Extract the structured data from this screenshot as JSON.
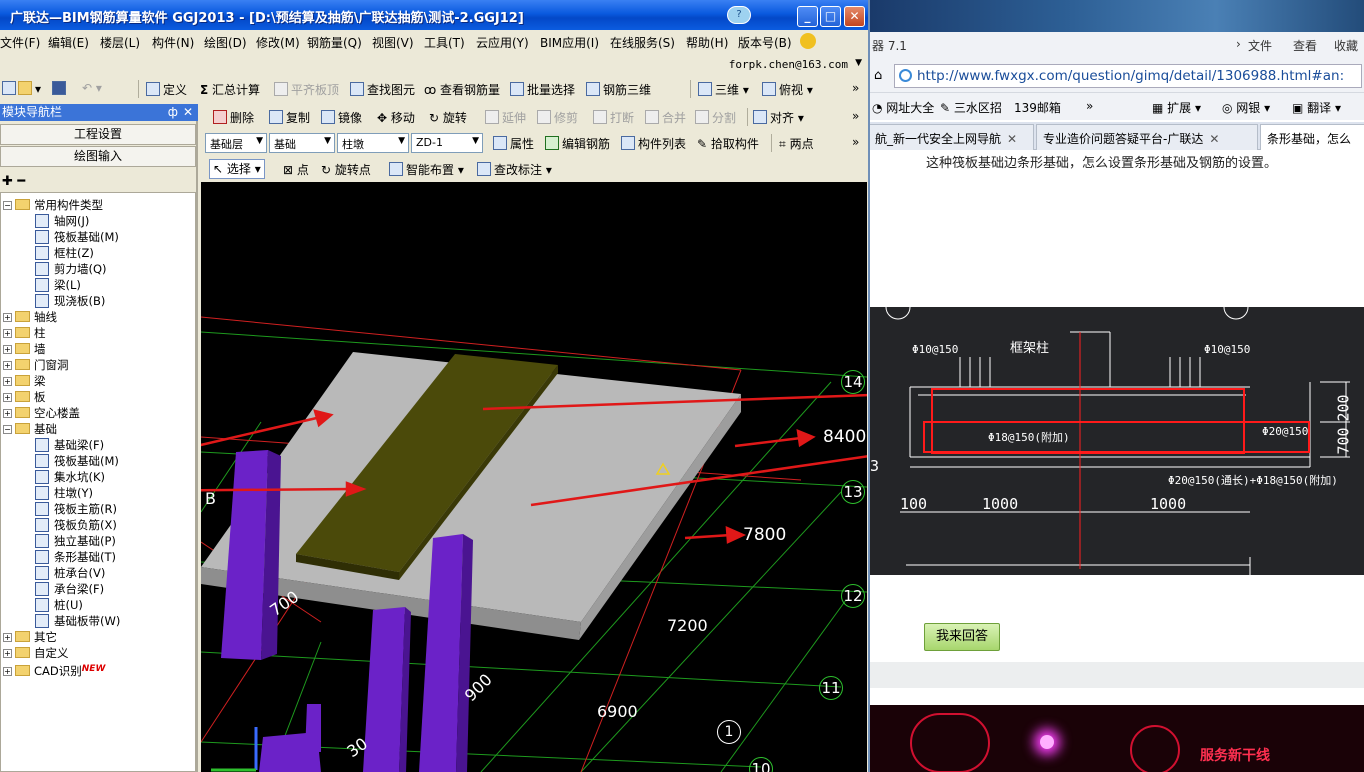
{
  "app": {
    "title": "广联达—BIM钢筋算量软件 GGJ2013 - [D:\\预结算及抽筋\\广联达抽筋\\测试-2.GGJ12]",
    "help_icon": "?",
    "win_buttons": {
      "minimize": "_",
      "maximize": "□",
      "close": "✕"
    },
    "menu": [
      "文件(F)",
      "编辑(E)",
      "楼层(L)",
      "构件(N)",
      "绘图(D)",
      "修改(M)",
      "钢筋量(Q)",
      "视图(V)",
      "工具(T)",
      "云应用(Y)",
      "BIM应用(I)",
      "在线服务(S)",
      "帮助(H)",
      "版本号(B)"
    ],
    "user_email": "forpk.chen@163.com",
    "toolbar1": {
      "define": "定义",
      "sum": "汇总计算",
      "flush": "平齐板顶",
      "find": "查找图元",
      "view_rebar": "查看钢筋量",
      "batch_select": "批量选择",
      "rebar_3d": "钢筋三维",
      "view_3d": "三维",
      "view_top": "俯视"
    },
    "toolbar2": {
      "delete": "删除",
      "copy": "复制",
      "mirror": "镜像",
      "move": "移动",
      "rotate": "旋转",
      "extend": "延伸",
      "trim": "修剪",
      "break": "打断",
      "merge": "合并",
      "split": "分割",
      "align": "对齐"
    },
    "toolbar3": {
      "layer": "基础层",
      "category": "基础",
      "type": "柱墩",
      "component": "ZD-1",
      "properties": "属性",
      "edit_rebar": "编辑钢筋",
      "component_list": "构件列表",
      "pick": "拾取构件",
      "two_points": "两点"
    },
    "toolbar4": {
      "select": "选择",
      "point": "点",
      "rotate_point": "旋转点",
      "smart_place": "智能布置",
      "modify_label": "查改标注"
    },
    "nav": {
      "title": "模块导航栏",
      "pin": "ф",
      "close": "✕",
      "btn_project": "工程设置",
      "btn_draw": "绘图输入",
      "tools": "✚ ━",
      "tree": [
        {
          "label": "常用构件类型",
          "level": 0,
          "kind": "folder",
          "expanded": true
        },
        {
          "label": "轴网(J)",
          "level": 1,
          "kind": "item"
        },
        {
          "label": "筏板基础(M)",
          "level": 1,
          "kind": "item"
        },
        {
          "label": "框柱(Z)",
          "level": 1,
          "kind": "item"
        },
        {
          "label": "剪力墙(Q)",
          "level": 1,
          "kind": "item"
        },
        {
          "label": "梁(L)",
          "level": 1,
          "kind": "item"
        },
        {
          "label": "现浇板(B)",
          "level": 1,
          "kind": "item"
        },
        {
          "label": "轴线",
          "level": 0,
          "kind": "folder",
          "expanded": false
        },
        {
          "label": "柱",
          "level": 0,
          "kind": "folder",
          "expanded": false
        },
        {
          "label": "墙",
          "level": 0,
          "kind": "folder",
          "expanded": false
        },
        {
          "label": "门窗洞",
          "level": 0,
          "kind": "folder",
          "expanded": false
        },
        {
          "label": "梁",
          "level": 0,
          "kind": "folder",
          "expanded": false
        },
        {
          "label": "板",
          "level": 0,
          "kind": "folder",
          "expanded": false
        },
        {
          "label": "空心楼盖",
          "level": 0,
          "kind": "folder",
          "expanded": false
        },
        {
          "label": "基础",
          "level": 0,
          "kind": "folder",
          "expanded": true
        },
        {
          "label": "基础梁(F)",
          "level": 1,
          "kind": "item"
        },
        {
          "label": "筏板基础(M)",
          "level": 1,
          "kind": "item"
        },
        {
          "label": "集水坑(K)",
          "level": 1,
          "kind": "item"
        },
        {
          "label": "柱墩(Y)",
          "level": 1,
          "kind": "item"
        },
        {
          "label": "筏板主筋(R)",
          "level": 1,
          "kind": "item"
        },
        {
          "label": "筏板负筋(X)",
          "level": 1,
          "kind": "item"
        },
        {
          "label": "独立基础(P)",
          "level": 1,
          "kind": "item"
        },
        {
          "label": "条形基础(T)",
          "level": 1,
          "kind": "item"
        },
        {
          "label": "桩承台(V)",
          "level": 1,
          "kind": "item"
        },
        {
          "label": "承台梁(F)",
          "level": 1,
          "kind": "item"
        },
        {
          "label": "桩(U)",
          "level": 1,
          "kind": "item"
        },
        {
          "label": "基础板带(W)",
          "level": 1,
          "kind": "item"
        },
        {
          "label": "其它",
          "level": 0,
          "kind": "folder",
          "expanded": false
        },
        {
          "label": "自定义",
          "level": 0,
          "kind": "folder",
          "expanded": false
        },
        {
          "label": "CAD识别",
          "level": 0,
          "kind": "folder",
          "expanded": false
        }
      ],
      "new_badge": "NEW"
    },
    "viewport": {
      "labels": {
        "l14": "14",
        "l13": "13",
        "l12": "12",
        "l11": "11",
        "l10": "10",
        "l1": "1",
        "lB": "B",
        "d8400": "8400",
        "d7800": "7800",
        "d7200": "7200",
        "d6900": "6900",
        "d700": "700",
        "d900": "900",
        "d30": "30"
      }
    }
  },
  "browser": {
    "top_label": "器 7.1",
    "top_menu": [
      "文件",
      "查看",
      "收藏"
    ],
    "url": "http://www.fwxgx.com/question/gimq/detail/1306988.html#an:",
    "favorites": [
      "网址大全",
      "三水区招",
      "139邮箱",
      "»",
      "扩展",
      "网银",
      "翻译"
    ],
    "tabs": [
      {
        "label": "航_新一代安全上网导航",
        "active": false
      },
      {
        "label": "专业造价问题答疑平台-广联达",
        "active": false
      },
      {
        "label": "条形基础，怎么",
        "active": true
      }
    ],
    "page_text": "这种筏板基础边条形基础，怎么设置条形基础及钢筋的设置。",
    "cad": {
      "t_frame_col": "框架柱",
      "t_10_150_l": "Φ10@150",
      "t_10_150_r": "Φ10@150",
      "t_18_150": "Φ18@150(附加)",
      "t_20_150": "Φ20@150",
      "t_bottom": "Φ20@150(通长)+Φ18@150(附加)",
      "t_100": "100",
      "t_1000a": "1000",
      "t_1000b": "1000",
      "t_200": "200",
      "t_700": "700",
      "t_3": "3"
    },
    "answer_button": "我来回答",
    "banner_text": "服务新干线"
  }
}
